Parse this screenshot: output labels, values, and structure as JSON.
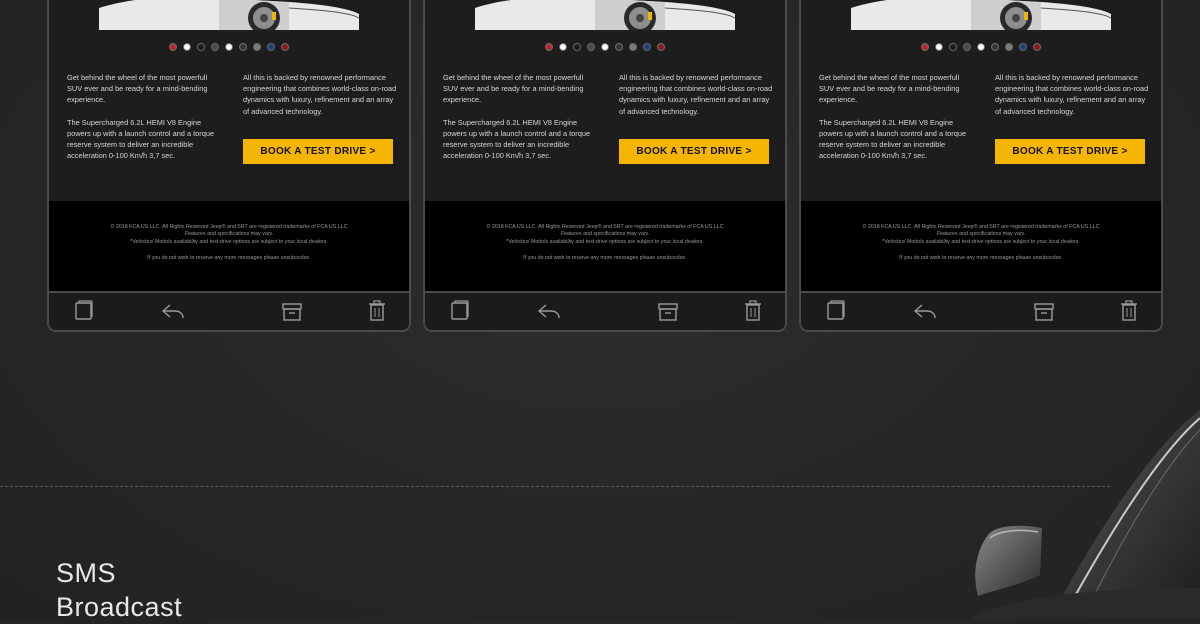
{
  "section_title_line1": "SMS",
  "section_title_line2": "Broadcast",
  "email": {
    "color_swatches": [
      "#c0272d",
      "#ffffff",
      "#1a1a1a",
      "#4a4a4a",
      "#ffffff",
      "#2f3a3a",
      "#7a7a7a",
      "#1f3f7a",
      "#8b1a22"
    ],
    "left_text": "Get behind the wheel of the most powerfull SUV ever and be ready for a mind-bending experience.\n\nThe Supercharged 6.2L HEMI V8 Engine powers up with a launch control and a torque reserve system to deliver an incredible acceleration 0-100 Km/h 3,7 sec.",
    "right_text": "All this is backed by renowned performance engineering that combines world-class on-road dynamics with luxury, refinement and an array of advanced technology.",
    "cta_label": "BOOK A TEST DRIVE  >",
    "legal_text": "© 2018 FCA US LLC. All Rights Reserved Jeep® and SRT are registered trademarks of FCA US LLC\nFeatures and specifications may vary.\n*Vehicles/ Models availability and test-drive options are subject to your local dealers.",
    "unsubscribe_text": "If you do not wish to receive any more messages please unsubscribe.",
    "accent_color": "#f5b500"
  },
  "toolbar_icons": [
    "compose-icon",
    "reply-icon",
    "archive-icon",
    "trash-icon"
  ]
}
